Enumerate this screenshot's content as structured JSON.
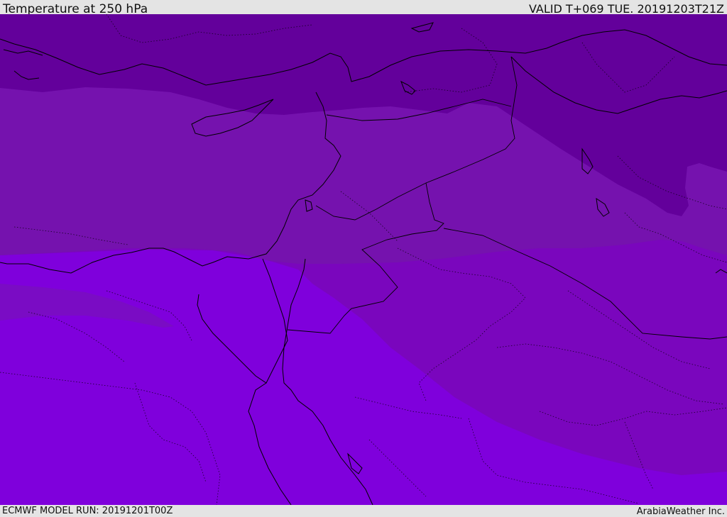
{
  "header": {
    "title": "Temperature at 250 hPa",
    "valid": "VALID T+069 TUE. 20191203T21Z"
  },
  "footer": {
    "model_run": "ECMWF MODEL RUN: 20191201T00Z",
    "credit": "ArabiaWeather Inc."
  },
  "map": {
    "colors": {
      "band_darkest": "#63009b",
      "band_dark": "#7512ae",
      "band_mid": "#7a06bd",
      "band_bright": "#7f00dc",
      "band_tongue": "#7a0cc4",
      "coastline": "#000000",
      "border": "#000000"
    }
  }
}
